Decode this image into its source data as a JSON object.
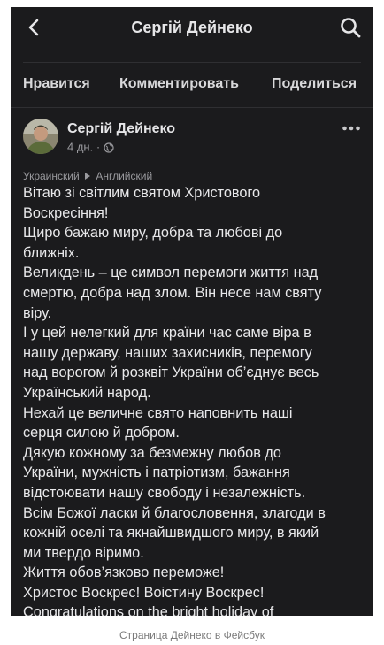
{
  "header": {
    "title": "Сергій Дейнеко",
    "back_icon": "chevron-left-icon",
    "search_icon": "search-icon"
  },
  "actions": {
    "like": "Нравится",
    "comment": "Комментировать",
    "share": "Поделиться"
  },
  "post": {
    "author": "Сергій Дейнеко",
    "time": "4 дн.",
    "separator": "·",
    "audience_icon": "globe-icon",
    "more_icon": "more-dots-icon",
    "translation": {
      "from": "Украинский",
      "to": "Английский"
    },
    "lines": [
      "Вітаю зі світлим святом Христового",
      "Воскресіння!",
      "Щиро бажаю миру, добра та любові до",
      "ближніх.",
      "Великдень – це символ перемоги життя над",
      "смертю, добра над злом. Він несе нам святу",
      "віру.",
      "І у цей нелегкий для країни час саме віра в",
      "нашу державу, наших захисників, перемогу",
      "над ворогом й розквіт України об’єднує весь",
      "Український народ.",
      "Нехай це величне свято наповнить наші",
      "серця силою й добром.",
      "Дякую кожному за безмежну любов до",
      "України, мужність і патріотизм, бажання",
      "відстоювати нашу свободу і незалежність.",
      "Всім Божої ласки й благословення, злагоди в",
      "кожній оселі та якнайшвидшого миру, в який",
      "ми твердо віримо.",
      "Життя обов’язково переможе!",
      "Христос Воскрес! Воістину Воскрес!",
      "Congratulations on the bright holiday of"
    ]
  },
  "caption": "Страница Дейнеко в Фейсбук"
}
